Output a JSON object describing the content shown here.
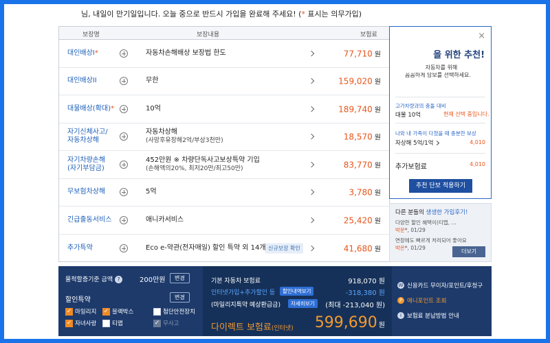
{
  "notice": {
    "text_main": "님, 내일이 만기일입니다. 오늘 중으로 반드시 가입을 완료해 주세요! (",
    "star": "*",
    "text_tail": " 표시는 의무가입)"
  },
  "table": {
    "headers": {
      "name": "보장명",
      "content": "보장내용",
      "premium": "보험료"
    },
    "rows": [
      {
        "name": "대인배상I",
        "required": true,
        "content": "자동차손해배상 보장법 한도",
        "sub": "",
        "badge": "",
        "price": "77,710",
        "unit": "원"
      },
      {
        "name": "대인배상II",
        "required": false,
        "content": "무한",
        "sub": "",
        "badge": "",
        "price": "159,020",
        "unit": "원"
      },
      {
        "name": "대물배상(확대)",
        "required": true,
        "content": "10억",
        "sub": "",
        "badge": "",
        "price": "189,740",
        "unit": "원"
      },
      {
        "name": "자기신체사고/",
        "name2": "자동차상해",
        "required": false,
        "content": "자동차상해",
        "sub": "(사망후유장해2억/부상3천만)",
        "badge": "",
        "price": "18,570",
        "unit": "원"
      },
      {
        "name": "자기차량손해",
        "name2": "(자기부담금)",
        "required": false,
        "content": "452만원 ※ 차량단독사고보상특약 기입",
        "sub": "(손해액의20%, 최저20만/최고50만)",
        "badge": "",
        "price": "83,770",
        "unit": "원"
      },
      {
        "name": "무보험차상해",
        "required": false,
        "content": "5억",
        "sub": "",
        "badge": "",
        "price": "3,780",
        "unit": "원"
      },
      {
        "name": "긴급출동서비스",
        "required": false,
        "content": "애니카서비스",
        "sub": "",
        "badge": "",
        "price": "25,420",
        "unit": "원"
      },
      {
        "name": "추가특약",
        "required": false,
        "content": "Eco e-약관(전자매일) 할인 특약 외 14개",
        "sub": "",
        "badge": "신규보장 확인",
        "price": "41,680",
        "unit": "원"
      }
    ]
  },
  "recommend": {
    "close": "×",
    "title": "을 위한 추천!",
    "desc1": "의 자동차를 위해",
    "desc2": "꼼꼼하게 담보를 선택하세요.",
    "item1_label": "고가차량과의 충돌 대비",
    "item1_value": "대물 10억",
    "item1_current": "현재 선택 중입니다.",
    "item2_label": "나와 내 가족이 다쳤을 때 충분한 보상",
    "item2_value": "자상해 5억/1억",
    "item2_price": "4,010",
    "add_label": "추가보험료",
    "add_price": "4,010",
    "apply": "추천 단보 적용하기"
  },
  "reviews": {
    "title_a": "다른 분들의 ",
    "title_b": "생생한 가입후기!",
    "r1_text": "다양한 할인 혜택이(티맵, ...",
    "r1_meta_a": "박문",
    "r1_meta_b": "*, 01/29",
    "r2_text": "연장에도 빠르게 처리되어 좋아요",
    "r2_meta_a": "박은",
    "r2_meta_b": "*, 01/29",
    "more": "더보기"
  },
  "bottom": {
    "damage_label": "물적할증기준 금액",
    "help": "?",
    "damage_value": "200만원",
    "change1": "변경",
    "discount_label": "할인특약",
    "change2": "변경",
    "checks": [
      {
        "label": "마일리지",
        "state": "on"
      },
      {
        "label": "블랙박스",
        "state": "on"
      },
      {
        "label": "첨단안전장치",
        "state": "off"
      },
      {
        "label": "자녀사랑",
        "state": "on"
      },
      {
        "label": "티맵",
        "state": "off"
      },
      {
        "label": "무사고",
        "state": "disabled"
      }
    ],
    "base_label": "기본 자동차 보험료",
    "base_value": "918,070 원",
    "disc_label": "인터넷가입+추가할인 등",
    "disc_pill": "할인내역보기",
    "disc_value": "-318,380 원",
    "mileage_label": "(마일리지특약 예상환급금)",
    "mileage_pill": "자세히보기",
    "mileage_value": "(최대 -213,040 원)",
    "direct_label": "다이렉트 보험료",
    "direct_sub": "(인터넷)",
    "direct_value": "599,690",
    "direct_unit": "원",
    "right_items": [
      {
        "icon": "W",
        "label": "신용카드 무이자/포인트/후청구",
        "style": "normal"
      },
      {
        "icon": "P",
        "label": "애니포인트 조회",
        "style": "orange"
      },
      {
        "icon": "i",
        "label": "보험료 분납방법 안내",
        "style": "normal"
      }
    ]
  }
}
